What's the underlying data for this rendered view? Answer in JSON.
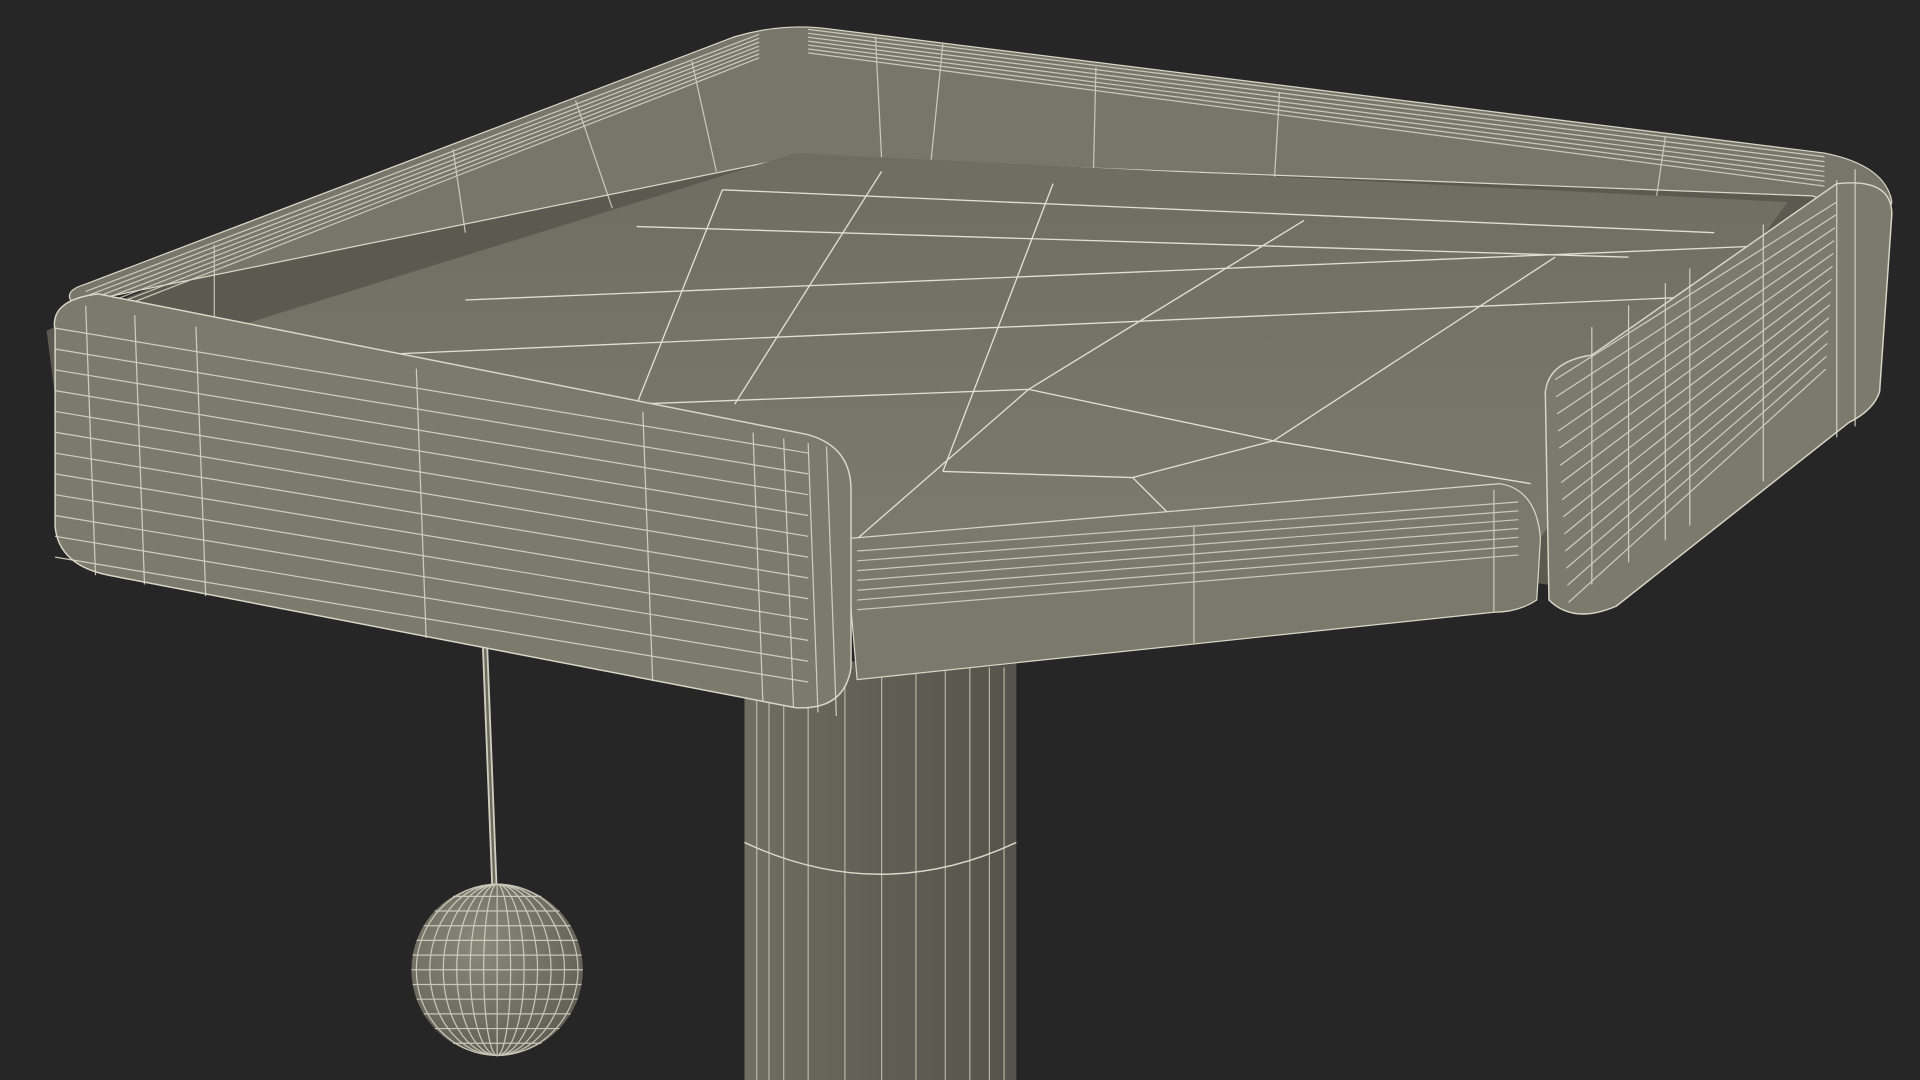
{
  "scene": {
    "subject": "wireframe-render",
    "colors": {
      "background": "#262626",
      "surface": "#7a7a6c",
      "surface_dark": "#5e5e53",
      "surface_shadow": "#4f4f46",
      "wire": "#d8d8c8"
    }
  }
}
